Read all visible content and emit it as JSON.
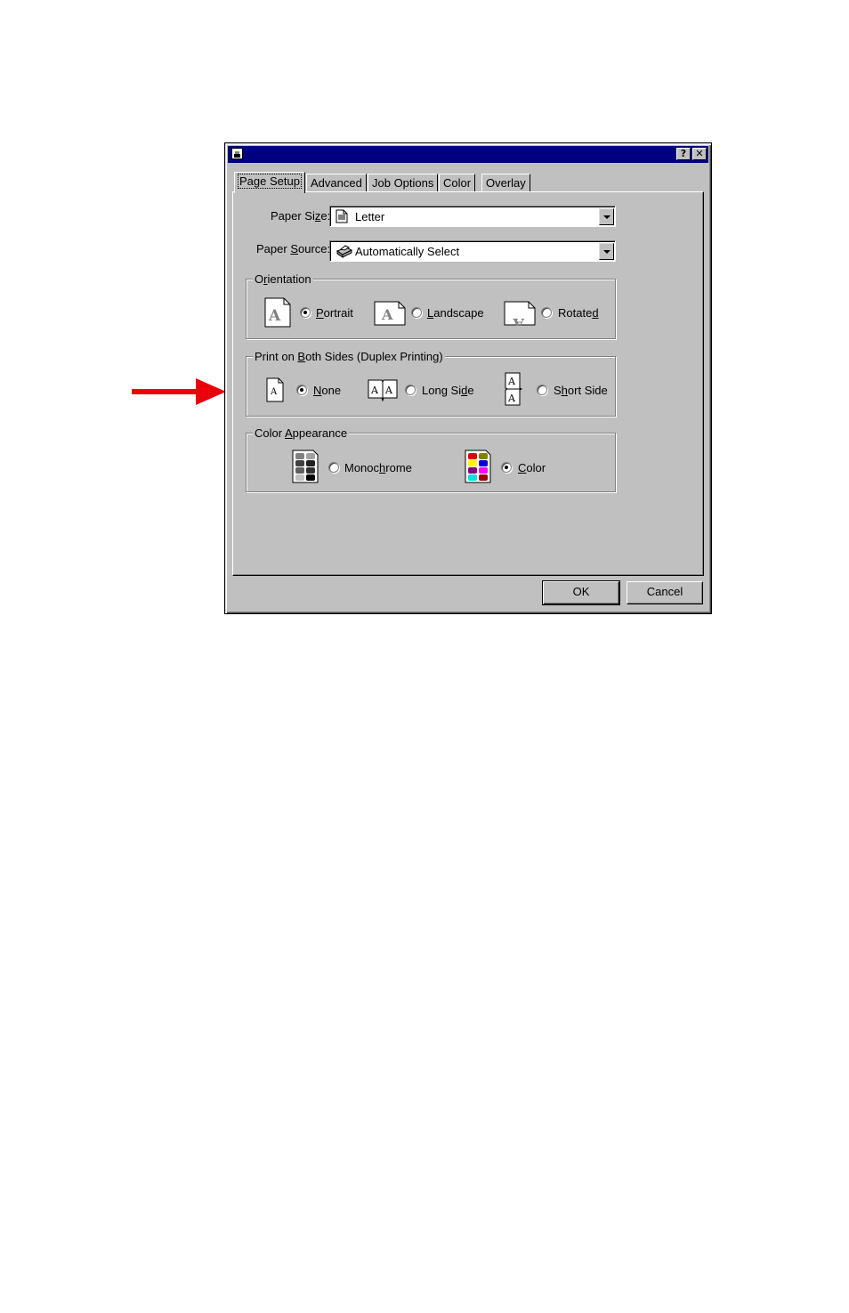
{
  "dialog": {
    "help_button": "?",
    "close_button": "✕"
  },
  "tabs": [
    {
      "label": "Page Setup",
      "active": true
    },
    {
      "label": "Advanced",
      "active": false
    },
    {
      "label": "Job Options",
      "active": false
    },
    {
      "label": "Color",
      "active": false
    },
    {
      "label": "Overlay",
      "active": false
    }
  ],
  "paper_size": {
    "label_pre": "Paper Si",
    "label_u": "z",
    "label_post": "e:",
    "value": "Letter",
    "icon": "document-icon"
  },
  "paper_source": {
    "label_pre": "Paper ",
    "label_u": "S",
    "label_post": "ource:",
    "value": "Automatically Select",
    "icon": "printer-icon"
  },
  "orientation": {
    "title_pre": "O",
    "title_u": "r",
    "title_post": "ientation",
    "options": [
      {
        "pre": "",
        "u": "P",
        "post": "ortrait",
        "checked": true
      },
      {
        "pre": "",
        "u": "L",
        "post": "andscape",
        "checked": false
      },
      {
        "pre": "Rotate",
        "u": "d",
        "post": "",
        "checked": false
      }
    ]
  },
  "duplex": {
    "title_pre": "Print on ",
    "title_u": "B",
    "title_post": "oth Sides (Duplex Printing)",
    "options": [
      {
        "pre": "",
        "u": "N",
        "post": "one",
        "checked": true
      },
      {
        "pre": "Long Si",
        "u": "d",
        "post": "e",
        "checked": false
      },
      {
        "pre": "S",
        "u": "h",
        "post": "ort Side",
        "checked": false
      }
    ]
  },
  "color_appearance": {
    "title_pre": "Color ",
    "title_u": "A",
    "title_post": "ppearance",
    "options": [
      {
        "pre": "Monoc",
        "u": "h",
        "post": "rome",
        "checked": false
      },
      {
        "pre": "",
        "u": "C",
        "post": "olor",
        "checked": true
      }
    ]
  },
  "buttons": {
    "ok": "OK",
    "cancel": "Cancel"
  },
  "colors": {
    "window_face": "#c0c0c0",
    "title_bar": "#000080",
    "arrow": "#e8000b"
  }
}
